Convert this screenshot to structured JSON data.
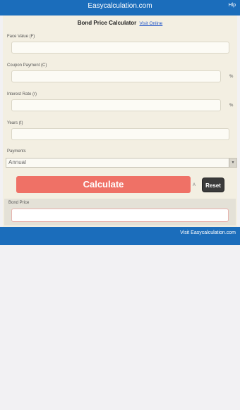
{
  "topbar": {
    "brand": "Easycalculation.com",
    "help": "Hlp"
  },
  "header": {
    "title": "Bond Price Calculator",
    "link": "Visit Online"
  },
  "fields": [
    {
      "label": "Face Value (F)",
      "unit": ""
    },
    {
      "label": "Coupon Payment (C)",
      "unit": "%"
    },
    {
      "label": "Interest Rate (r)",
      "unit": "%"
    },
    {
      "label": "Years (t)",
      "unit": ""
    }
  ],
  "payments": {
    "label": "Payments",
    "selected": "Annual"
  },
  "buttons": {
    "calculate": "Calculate",
    "a_mark": "A",
    "reset": "Reset"
  },
  "result": {
    "label": "Bond Price",
    "value": ""
  },
  "footer": {
    "link": "Visit Easycalculation.com"
  }
}
